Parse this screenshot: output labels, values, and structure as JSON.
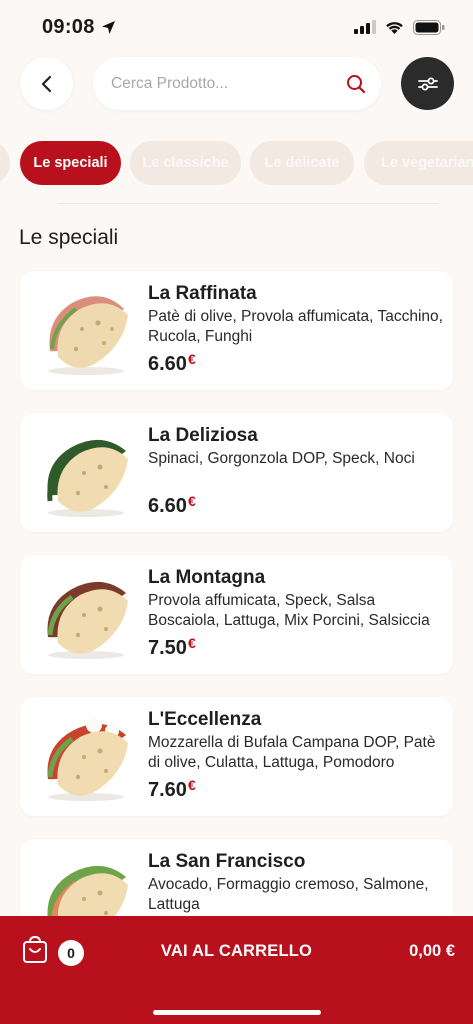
{
  "status_bar": {
    "time": "09:08"
  },
  "search": {
    "placeholder": "Cerca Prodotto..."
  },
  "tabs": [
    {
      "label": "Le speciali",
      "active": true
    },
    {
      "label": "Le classiche",
      "active": false
    },
    {
      "label": "Le delicate",
      "active": false
    },
    {
      "label": "Le vegetariane",
      "active": false
    }
  ],
  "section": {
    "title": "Le speciali"
  },
  "products": [
    {
      "name": "La Raffinata",
      "description": "Patè di olive, Provola affumicata, Tacchino, Rucola, Funghi",
      "price": "6.60",
      "currency": "€"
    },
    {
      "name": "La Deliziosa",
      "description": "Spinaci, Gorgonzola DOP, Speck, Noci",
      "price": "6.60",
      "currency": "€"
    },
    {
      "name": "La Montagna",
      "description": "Provola affumicata, Speck, Salsa Boscaiola, Lattuga, Mix Porcini, Salsiccia",
      "price": "7.50",
      "currency": "€"
    },
    {
      "name": "L'Eccellenza",
      "description": "Mozzarella di Bufala Campana DOP, Patè di olive, Culatta, Lattuga, Pomodoro",
      "price": "7.60",
      "currency": "€"
    },
    {
      "name": "La San Francisco",
      "description": "Avocado, Formaggio cremoso, Salmone, Lattuga",
      "price": "",
      "currency": ""
    }
  ],
  "cart": {
    "count": "0",
    "cta_label": "VAI AL CARRELLO",
    "total": "0,00 €"
  },
  "colors": {
    "accent": "#b8101d",
    "background": "#fbf8f5",
    "dark_button": "#2b2b2b"
  },
  "icons": {
    "back": "chevron-left-icon",
    "search": "search-icon",
    "filter": "sliders-icon",
    "cart": "shopping-bag-icon",
    "location": "location-arrow-icon"
  }
}
